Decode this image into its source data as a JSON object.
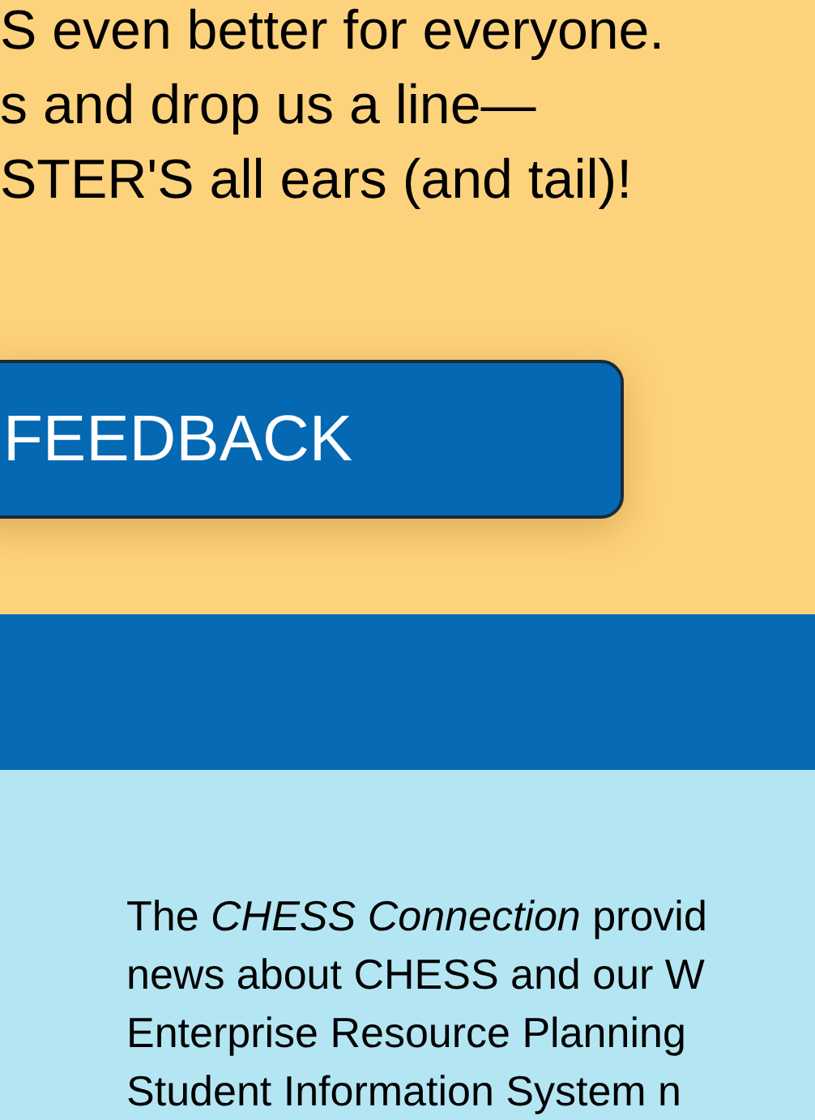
{
  "appeal": {
    "lines": [
      "S even better for everyone.",
      "s and drop us a line—",
      "STER'S all ears (and tail)!"
    ]
  },
  "feedback_button": {
    "label": "FEEDBACK"
  },
  "about": {
    "lines": [
      "The *CHESS Connection* provid",
      "news about CHESS and our W",
      "Enterprise Resource Planning",
      "Student Information System n"
    ]
  }
}
